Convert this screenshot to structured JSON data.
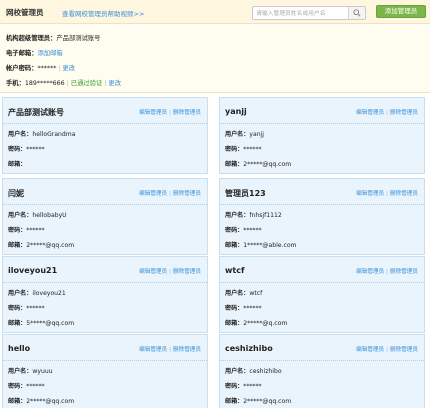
{
  "header": {
    "title": "网校管理员",
    "help_link": "查看网校管理员帮助视频>>",
    "search_placeholder": "请输入管理员姓名或用户名",
    "search_icon": "search-icon",
    "add_button": "添加管理员"
  },
  "info": {
    "org_label": "机构超级管理员：",
    "org_value": "产品部测试账号",
    "email_label": "电子邮箱：",
    "email_link": "添加邮箱",
    "password_label": "帐户密码：",
    "password_value": "******",
    "password_action": "更改",
    "phone_label": "手机：",
    "phone_value": "189*****666",
    "phone_verified": "已通过验证",
    "phone_action": "更改"
  },
  "card_labels": {
    "edit": "编辑管理员",
    "delete": "删除管理员",
    "username": "用户名：",
    "password": "密码：",
    "email": "邮箱："
  },
  "admins": [
    {
      "name": "产品部测试账号",
      "username": "helloGrandma",
      "password": "******",
      "email": ""
    },
    {
      "name": "yanjj",
      "username": "yanjj",
      "password": "******",
      "email": "2*****@qq.com"
    },
    {
      "name": "闫妮",
      "username": "hellobabyU",
      "password": "******",
      "email": "2*****@qq.com"
    },
    {
      "name": "管理员123",
      "username": "fnhsjf1112",
      "password": "******",
      "email": "1*****@able.com"
    },
    {
      "name": "iloveyou21",
      "username": "iloveyou21",
      "password": "******",
      "email": "5*****@qq.com"
    },
    {
      "name": "wtcf",
      "username": "wtcf",
      "password": "******",
      "email": "2*****@q.com"
    },
    {
      "name": "hello",
      "username": "wyuuu",
      "password": "******",
      "email": "2*****@qq.com"
    },
    {
      "name": "ceshizhibo",
      "username": "ceshizhibo",
      "password": "******",
      "email": "2*****@qq.com"
    }
  ],
  "colors": {
    "accent": "#3a8fd8",
    "add_button": "#7cb64a",
    "verified": "#3a9d28",
    "card_bg": "#e9f4fc",
    "header_bg": "#fff6df"
  }
}
